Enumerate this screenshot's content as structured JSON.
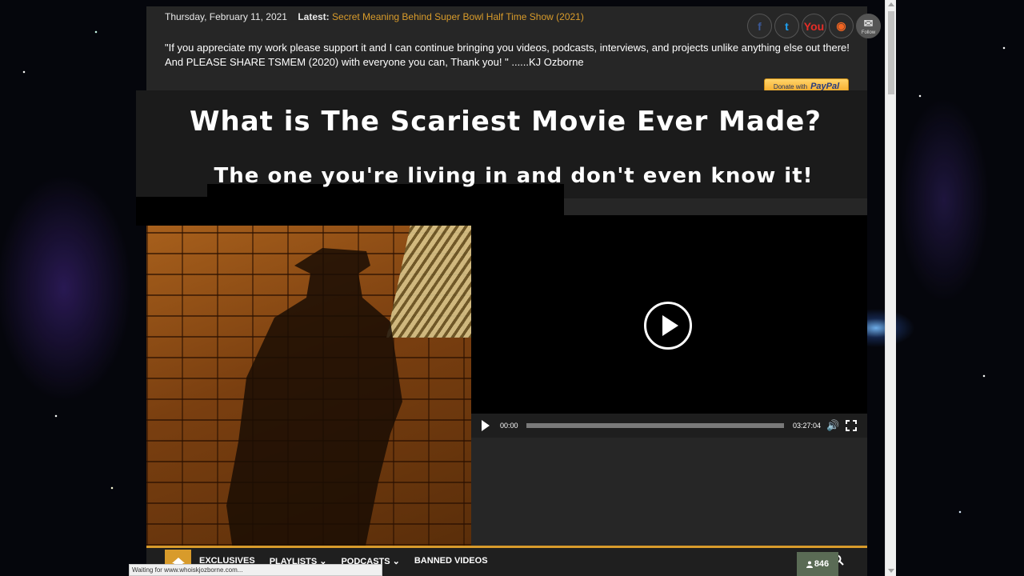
{
  "topbar": {
    "date": "Thursday, February 11, 2021",
    "latest_label": "Latest:",
    "latest_link": "Secret Meaning Behind Super Bowl Half Time Show (2021)"
  },
  "social": {
    "facebook_glyph": "f",
    "twitter_glyph": "t",
    "youtube_glyph": "You",
    "rss_glyph": "◉",
    "mail_glyph": "✉",
    "mail_label": "Follow"
  },
  "quote": {
    "line1": "\"If you appreciate my work please support it and I can continue bringing you videos, podcasts, interviews, and projects unlike anything else out there!",
    "line2": "And PLEASE SHARE TSMEM (2020) with everyone you can, Thank you! \" ......KJ Ozborne"
  },
  "donate": {
    "prefix": "Donate with",
    "brand": "PayPal"
  },
  "headline": {
    "title": "What is The Scariest Movie Ever Made?",
    "subtitle": "The one you're living in and don't even know it!"
  },
  "player": {
    "current_time": "00:00",
    "duration": "03:27:04",
    "progress": 0,
    "volume_glyph": "🔊"
  },
  "nav": {
    "items": [
      "EXCLUSIVES",
      "PLAYLISTS ⌄",
      "PODCASTS ⌄",
      "BANNED VIDEOS"
    ]
  },
  "counter": {
    "value": "846"
  },
  "statusbar": {
    "text": "Waiting for www.whoiskjozborne.com..."
  },
  "colors": {
    "accent": "#d89b2b",
    "panel": "#262626"
  }
}
